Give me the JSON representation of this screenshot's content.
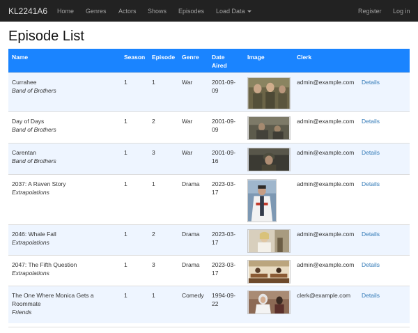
{
  "navbar": {
    "brand": "KL2241A6",
    "links": [
      "Home",
      "Genres",
      "Actors",
      "Shows",
      "Episodes",
      "Load Data"
    ],
    "right_links": [
      "Register",
      "Log in"
    ]
  },
  "page": {
    "title": "Episode List"
  },
  "table": {
    "headers": {
      "name": "Name",
      "season": "Season",
      "episode": "Episode",
      "genre": "Genre",
      "date_aired_1": "Date",
      "date_aired_2": "Aired",
      "image": "Image",
      "clerk": "Clerk"
    },
    "rows": [
      {
        "name": "Currahee",
        "series": "Band of Brothers",
        "season": "1",
        "episode": "1",
        "genre": "War",
        "date_1": "2001-09-",
        "date_2": "09",
        "clerk": "admin@example.com",
        "action": "Details"
      },
      {
        "name": "Day of Days",
        "series": "Band of Brothers",
        "season": "1",
        "episode": "2",
        "genre": "War",
        "date_1": "2001-09-",
        "date_2": "09",
        "clerk": "admin@example.com",
        "action": "Details"
      },
      {
        "name": "Carentan",
        "series": "Band of Brothers",
        "season": "1",
        "episode": "3",
        "genre": "War",
        "date_1": "2001-09-",
        "date_2": "16",
        "clerk": "admin@example.com",
        "action": "Details"
      },
      {
        "name": "2037: A Raven Story",
        "series": "Extrapolations",
        "season": "1",
        "episode": "1",
        "genre": "Drama",
        "date_1": "2023-03-",
        "date_2": "17",
        "clerk": "admin@example.com",
        "action": "Details"
      },
      {
        "name": "2046: Whale Fall",
        "series": "Extrapolations",
        "season": "1",
        "episode": "2",
        "genre": "Drama",
        "date_1": "2023-03-",
        "date_2": "17",
        "clerk": "admin@example.com",
        "action": "Details"
      },
      {
        "name": "2047: The Fifth Question",
        "series": "Extrapolations",
        "season": "1",
        "episode": "3",
        "genre": "Drama",
        "date_1": "2023-03-",
        "date_2": "17",
        "clerk": "admin@example.com",
        "action": "Details"
      },
      {
        "name_1": "The One Where Monica Gets a",
        "name_2": "Roommate",
        "series": "Friends",
        "season": "1",
        "episode": "1",
        "genre": "Comedy",
        "date_1": "1994-09-",
        "date_2": "22",
        "clerk": "clerk@example.com",
        "action": "Details"
      }
    ]
  },
  "colors": {
    "navbar": "#222222",
    "table_header": "#1a84ff",
    "stripe": "#eef5ff",
    "link": "#337ab7"
  }
}
